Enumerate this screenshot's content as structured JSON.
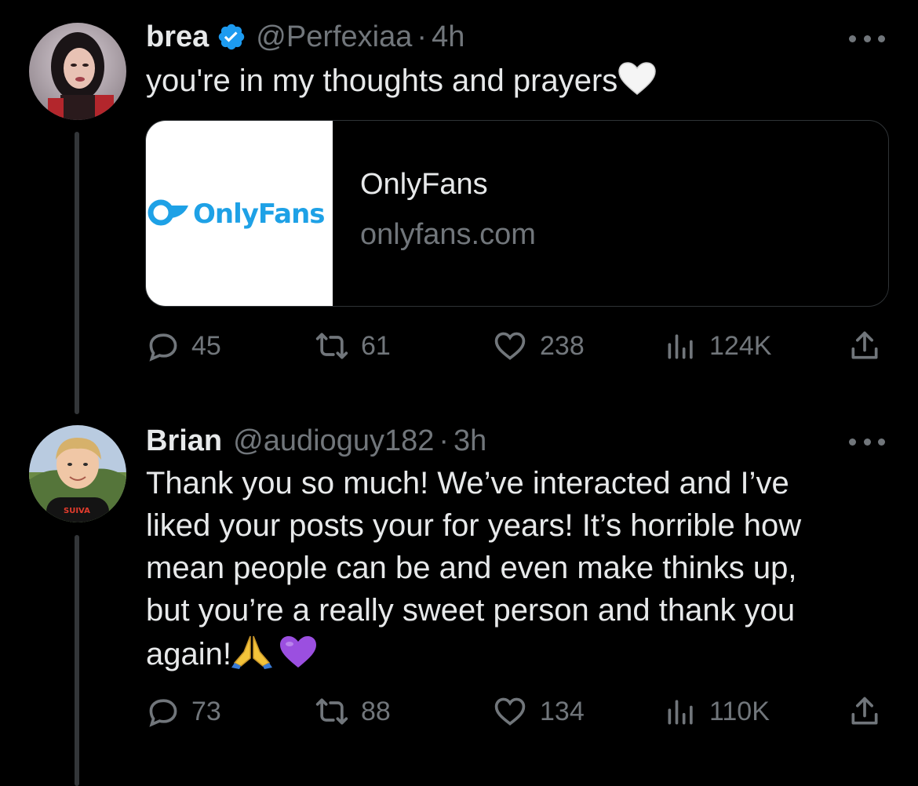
{
  "tweets": [
    {
      "name": "brea",
      "verified": true,
      "handle": "@Perfexiaa",
      "separator": "·",
      "time": "4h",
      "text": "you're in my thoughts and prayers",
      "emoji": "white-heart",
      "card": {
        "logo_text": "OnlyFans",
        "title": "OnlyFans",
        "domain": "onlyfans.com"
      },
      "replies": "45",
      "reposts": "61",
      "likes": "238",
      "views": "124K"
    },
    {
      "name": "Brian",
      "verified": false,
      "handle": "@audioguy182",
      "separator": "·",
      "time": "3h",
      "text_lines": [
        "Thank you so much! We’ve interacted and I’ve",
        "liked your posts your for years! It’s horrible how",
        "mean people can be and even make thinks up,",
        "but you’re a really sweet person and thank you",
        "again!"
      ],
      "emojis": [
        "folded-hands",
        "purple-heart"
      ],
      "replies": "73",
      "reposts": "88",
      "likes": "134",
      "views": "110K"
    }
  ],
  "colors": {
    "background": "#000000",
    "text": "#e7e9ea",
    "secondary": "#71767b",
    "verified_blue": "#1d9bf0",
    "card_border": "#2f3336",
    "onlyfans_blue": "#1ea1e6"
  }
}
